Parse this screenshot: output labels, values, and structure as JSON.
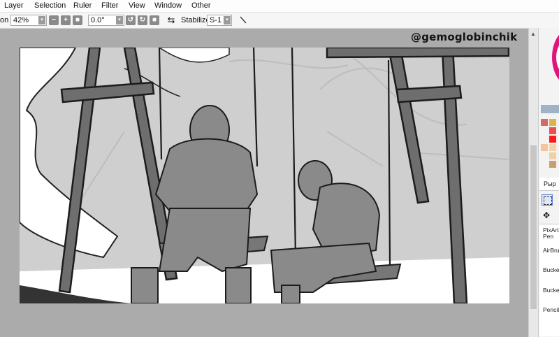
{
  "menu": [
    {
      "label": "Layer"
    },
    {
      "label": "Selection"
    },
    {
      "label": "Ruler"
    },
    {
      "label": "Filter"
    },
    {
      "label": "View"
    },
    {
      "label": "Window"
    },
    {
      "label": "Other"
    }
  ],
  "toolbar": {
    "zoom_label_partial": "on",
    "zoom_value": "42%",
    "angle_value": "0.0°",
    "stabilizer_label": "Stabilizer",
    "stabilizer_value": "S-1"
  },
  "watermark": "@gemoglobinchik",
  "panel": {
    "tab_label": "Рыр",
    "tools": [
      "PixArt Pen",
      "AirBrus",
      "Bucket",
      "Bucket",
      "Pencil"
    ]
  },
  "colors": {
    "accent_pink": "#e0157a",
    "swatches": [
      "#d46a6a",
      "#dfb34a",
      "#f2f2f2",
      "#e85050",
      "#ff1a1a",
      "#f6c49c",
      "#f1d4ae",
      "#ead3a6",
      "#c9a06c"
    ]
  },
  "icons": [
    "zoom-out-icon",
    "zoom-in-icon",
    "zoom-reset-icon",
    "rotate-left-icon",
    "rotate-right-icon",
    "rotate-reset-icon",
    "flip-icon",
    "brush-line-icon",
    "select-rect-icon",
    "move-icon",
    "scroll-up-icon"
  ]
}
